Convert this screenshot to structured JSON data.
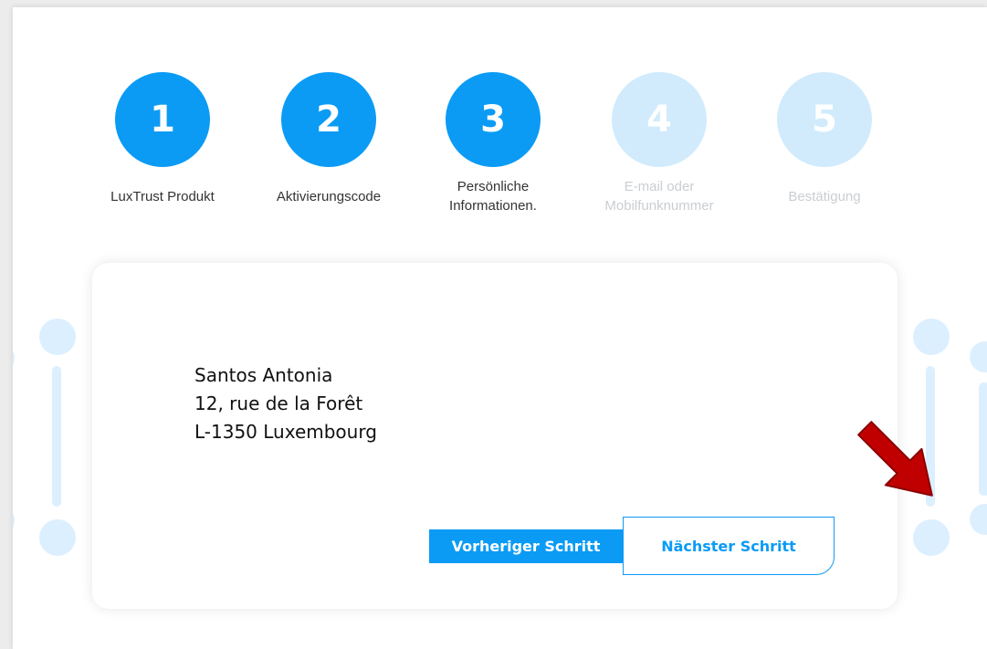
{
  "stepper": {
    "steps": [
      {
        "number": "1",
        "label": "LuxTrust Produkt",
        "state": "completed"
      },
      {
        "number": "2",
        "label": "Aktivierungscode",
        "state": "completed"
      },
      {
        "number": "3",
        "label_line1": "Persönliche",
        "label_line2": "Informationen.",
        "state": "current"
      },
      {
        "number": "4",
        "label_line1": "E-mail oder",
        "label_line2": "Mobilfunknummer",
        "state": "upcoming"
      },
      {
        "number": "5",
        "label": "Bestätigung",
        "state": "upcoming"
      }
    ]
  },
  "address": {
    "name": "Santos Antonia",
    "street": "12, rue de la Forêt",
    "city": "L-1350 Luxembourg"
  },
  "buttons": {
    "previous_label": "Vorheriger Schritt",
    "next_label": "Nächster Schritt"
  },
  "colors": {
    "accent": "#0b9bf5",
    "inactive_step": "#d1ebfd",
    "annotation_arrow": "#c00000"
  }
}
